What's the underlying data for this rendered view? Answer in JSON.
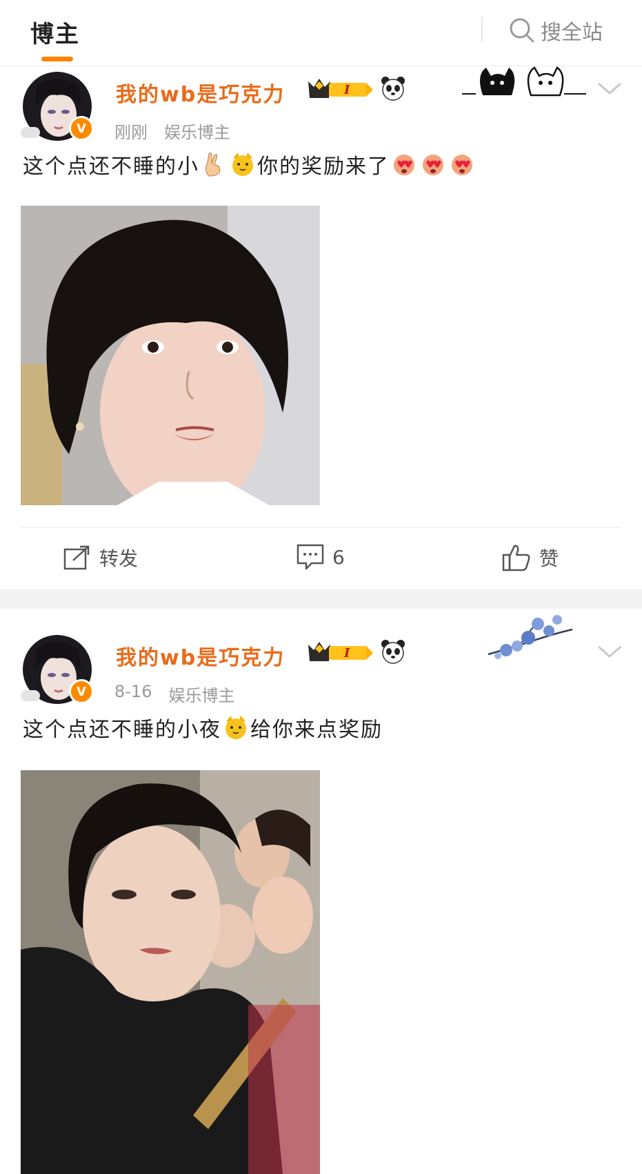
{
  "header": {
    "active_tab": "博主",
    "search_label": "搜全站"
  },
  "posts": [
    {
      "username": "我的wb是巧克力",
      "level_badge": "I",
      "timestamp": "刚刚",
      "category": "娱乐博主",
      "text_parts": [
        "这个点还不睡的小",
        "你的奖励来了"
      ],
      "emojis": [
        "victory-hand",
        "cat-face",
        "heart-eyes",
        "heart-eyes",
        "heart-eyes"
      ],
      "actions": {
        "repost_label": "转发",
        "comment_count": "6",
        "like_label": "赞"
      }
    },
    {
      "username": "我的wb是巧克力",
      "level_badge": "I",
      "timestamp": "8-16",
      "category": "娱乐博主",
      "text_parts": [
        "这个点还不睡的小夜",
        "给你来点奖励"
      ],
      "emojis": [
        "cat-face"
      ]
    }
  ],
  "colors": {
    "accent": "#ff8200",
    "username": "#e86b1a",
    "meta": "#9a9a9a",
    "separator": "#f2f2f2"
  }
}
